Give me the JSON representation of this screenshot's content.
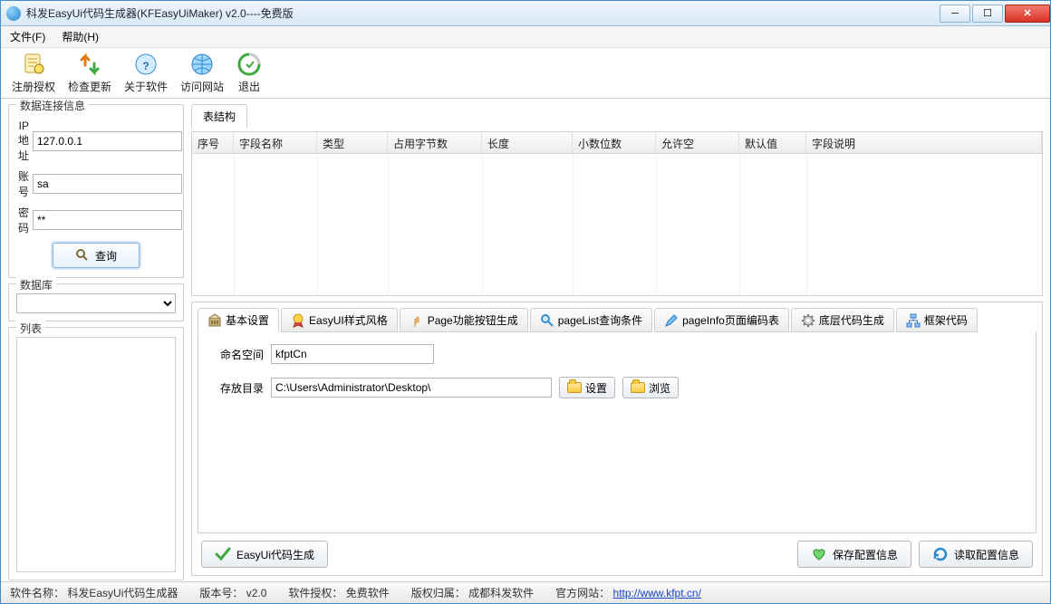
{
  "title": "科发EasyUi代码生成器(KFEasyUiMaker) v2.0----免费版",
  "menu": {
    "file": "文件(F)",
    "help": "帮助(H)"
  },
  "toolbar": {
    "register": "注册授权",
    "update": "检查更新",
    "about": "关于软件",
    "website": "访问网站",
    "exit": "退出"
  },
  "conn": {
    "legend": "数据连接信息",
    "ip_label": "IP地址",
    "ip_value": "127.0.0.1",
    "user_label": "账号",
    "user_value": "sa",
    "pwd_label": "密码",
    "pwd_value": "**",
    "query_btn": "查询"
  },
  "db": {
    "legend": "数据库",
    "selected": ""
  },
  "list": {
    "legend": "列表"
  },
  "table_tab": "表结构",
  "columns": {
    "seq": "序号",
    "name": "字段名称",
    "type": "类型",
    "bytes": "占用字节数",
    "length": "长度",
    "scale": "小数位数",
    "nullable": "允许空",
    "default": "默认值",
    "desc": "字段说明"
  },
  "settings_tabs": {
    "basic": "基本设置",
    "style": "EasyUI样式风格",
    "page": "Page功能按钮生成",
    "pagelist": "pageList查询条件",
    "pageinfo": "pageInfo页面编码表",
    "core": "底层代码生成",
    "frame": "框架代码"
  },
  "settings": {
    "ns_label": "命名空间",
    "ns_value": "kfptCn",
    "dir_label": "存放目录",
    "dir_value": "C:\\Users\\Administrator\\Desktop\\",
    "set_btn": "设置",
    "browse_btn": "浏览"
  },
  "actions": {
    "generate": "EasyUi代码生成",
    "save_cfg": "保存配置信息",
    "load_cfg": "读取配置信息"
  },
  "status": {
    "name_label": "软件名称：",
    "name_value": "科发EasyUi代码生成器",
    "version_label": "版本号：",
    "version_value": "v2.0",
    "license_label": "软件授权：",
    "license_value": "免费软件",
    "copyright_label": "版权归属：",
    "copyright_value": "成都科发软件",
    "site_label": "官方网站：",
    "site_value": "http://www.kfpt.cn/"
  }
}
